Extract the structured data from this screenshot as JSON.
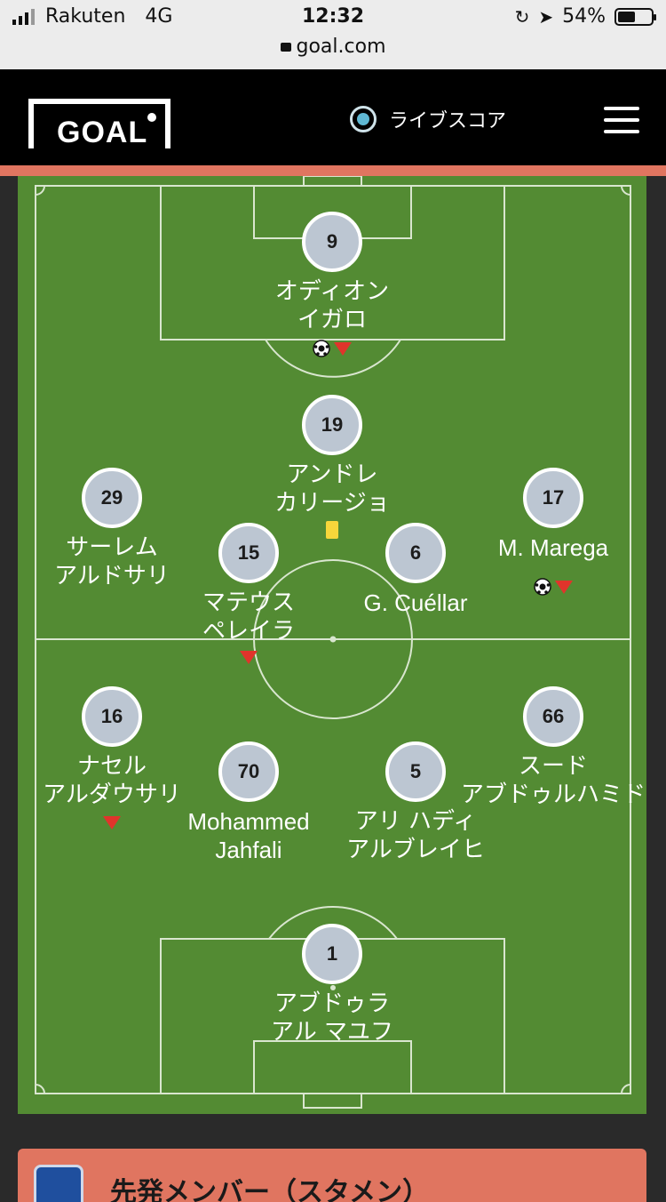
{
  "status_bar": {
    "carrier": "Rakuten",
    "network": "4G",
    "time": "12:32",
    "url": "goal.com",
    "battery_percent": "54%",
    "battery_level": 0.54
  },
  "header": {
    "logo_text": "GOAL",
    "live_score_label": "ライブスコア"
  },
  "colors": {
    "pitch": "#538b33",
    "accent": "#e07560",
    "player_badge": "#bcc6d2",
    "sub_marker": "#e0342b",
    "yellow_card": "#f6d63b"
  },
  "players": [
    {
      "number": "9",
      "name_line1": "オディオン",
      "name_line2": "イガロ",
      "goal": true,
      "sub_off": true,
      "yellow_card": false
    },
    {
      "number": "19",
      "name_line1": "アンドレ",
      "name_line2": "カリージョ",
      "goal": false,
      "sub_off": false,
      "yellow_card": true
    },
    {
      "number": "29",
      "name_line1": "サーレム",
      "name_line2": "アルドサリ",
      "goal": false,
      "sub_off": false,
      "yellow_card": false
    },
    {
      "number": "17",
      "name_line1": "M. Marega",
      "name_line2": "",
      "goal": true,
      "sub_off": true,
      "yellow_card": false
    },
    {
      "number": "15",
      "name_line1": "マテウス",
      "name_line2": "ペレイラ",
      "goal": false,
      "sub_off": true,
      "yellow_card": false
    },
    {
      "number": "6",
      "name_line1": "G. Cuéllar",
      "name_line2": "",
      "goal": false,
      "sub_off": false,
      "yellow_card": false
    },
    {
      "number": "16",
      "name_line1": "ナセル",
      "name_line2": "アルダウサリ",
      "goal": false,
      "sub_off": true,
      "yellow_card": false
    },
    {
      "number": "66",
      "name_line1": "スード",
      "name_line2": "アブドゥルハミド",
      "goal": false,
      "sub_off": false,
      "yellow_card": false
    },
    {
      "number": "70",
      "name_line1": "Mohammed",
      "name_line2": "Jahfali",
      "goal": false,
      "sub_off": false,
      "yellow_card": false
    },
    {
      "number": "5",
      "name_line1": "アリ ハディ",
      "name_line2": "アルブレイヒ",
      "goal": false,
      "sub_off": false,
      "yellow_card": false
    },
    {
      "number": "1",
      "name_line1": "アブドゥラ",
      "name_line2": "アル マユフ",
      "goal": false,
      "sub_off": false,
      "yellow_card": false
    }
  ],
  "lineup_section": {
    "title": "先発メンバー（スタメン）"
  }
}
